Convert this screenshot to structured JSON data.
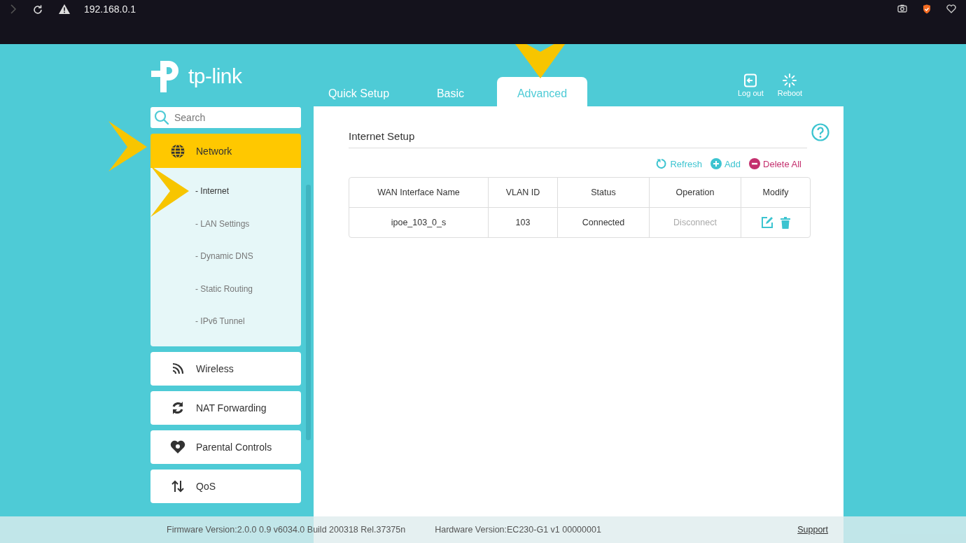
{
  "browser": {
    "url": "192.168.0.1"
  },
  "logo": {
    "text": "tp-link"
  },
  "tabs": [
    {
      "label": "Quick Setup",
      "selected": false
    },
    {
      "label": "Basic",
      "selected": false
    },
    {
      "label": "Advanced",
      "selected": true
    }
  ],
  "header_actions": [
    {
      "kind": "logout",
      "label": "Log out"
    },
    {
      "kind": "reboot",
      "label": "Reboot"
    }
  ],
  "search": {
    "placeholder": "Search"
  },
  "sidebar": {
    "items": [
      {
        "kind": "network",
        "label": "Network",
        "selected": true,
        "expanded": true,
        "children": [
          {
            "label": "- Internet",
            "selected": true
          },
          {
            "label": "- LAN Settings",
            "selected": false
          },
          {
            "label": "- Dynamic DNS",
            "selected": false
          },
          {
            "label": "- Static Routing",
            "selected": false
          },
          {
            "label": "- IPv6 Tunnel",
            "selected": false
          }
        ]
      },
      {
        "kind": "wireless",
        "label": "Wireless",
        "selected": false,
        "expanded": false
      },
      {
        "kind": "nat",
        "label": "NAT Forwarding",
        "selected": false,
        "expanded": false
      },
      {
        "kind": "parental",
        "label": "Parental Controls",
        "selected": false,
        "expanded": false
      },
      {
        "kind": "qos",
        "label": "QoS",
        "selected": false,
        "expanded": false
      }
    ]
  },
  "panel": {
    "title": "Internet Setup",
    "actions": [
      {
        "kind": "refresh",
        "label": "Refresh"
      },
      {
        "kind": "add",
        "label": "Add"
      },
      {
        "kind": "delete",
        "label": "Delete All"
      }
    ],
    "table": {
      "columns": [
        "WAN Interface Name",
        "VLAN ID",
        "Status",
        "Operation",
        "Modify"
      ],
      "rows": [
        {
          "name": "ipoe_103_0_s",
          "vlan_id": "103",
          "status": "Connected",
          "operation": {
            "label": "Disconnect",
            "disabled": true
          }
        }
      ]
    }
  },
  "footer": {
    "firmware": "Firmware Version:2.0.0 0.9 v6034.0 Build 200318 Rel.37375n",
    "hardware": "Hardware Version:EC230-G1 v1 00000001",
    "support": "Support"
  }
}
